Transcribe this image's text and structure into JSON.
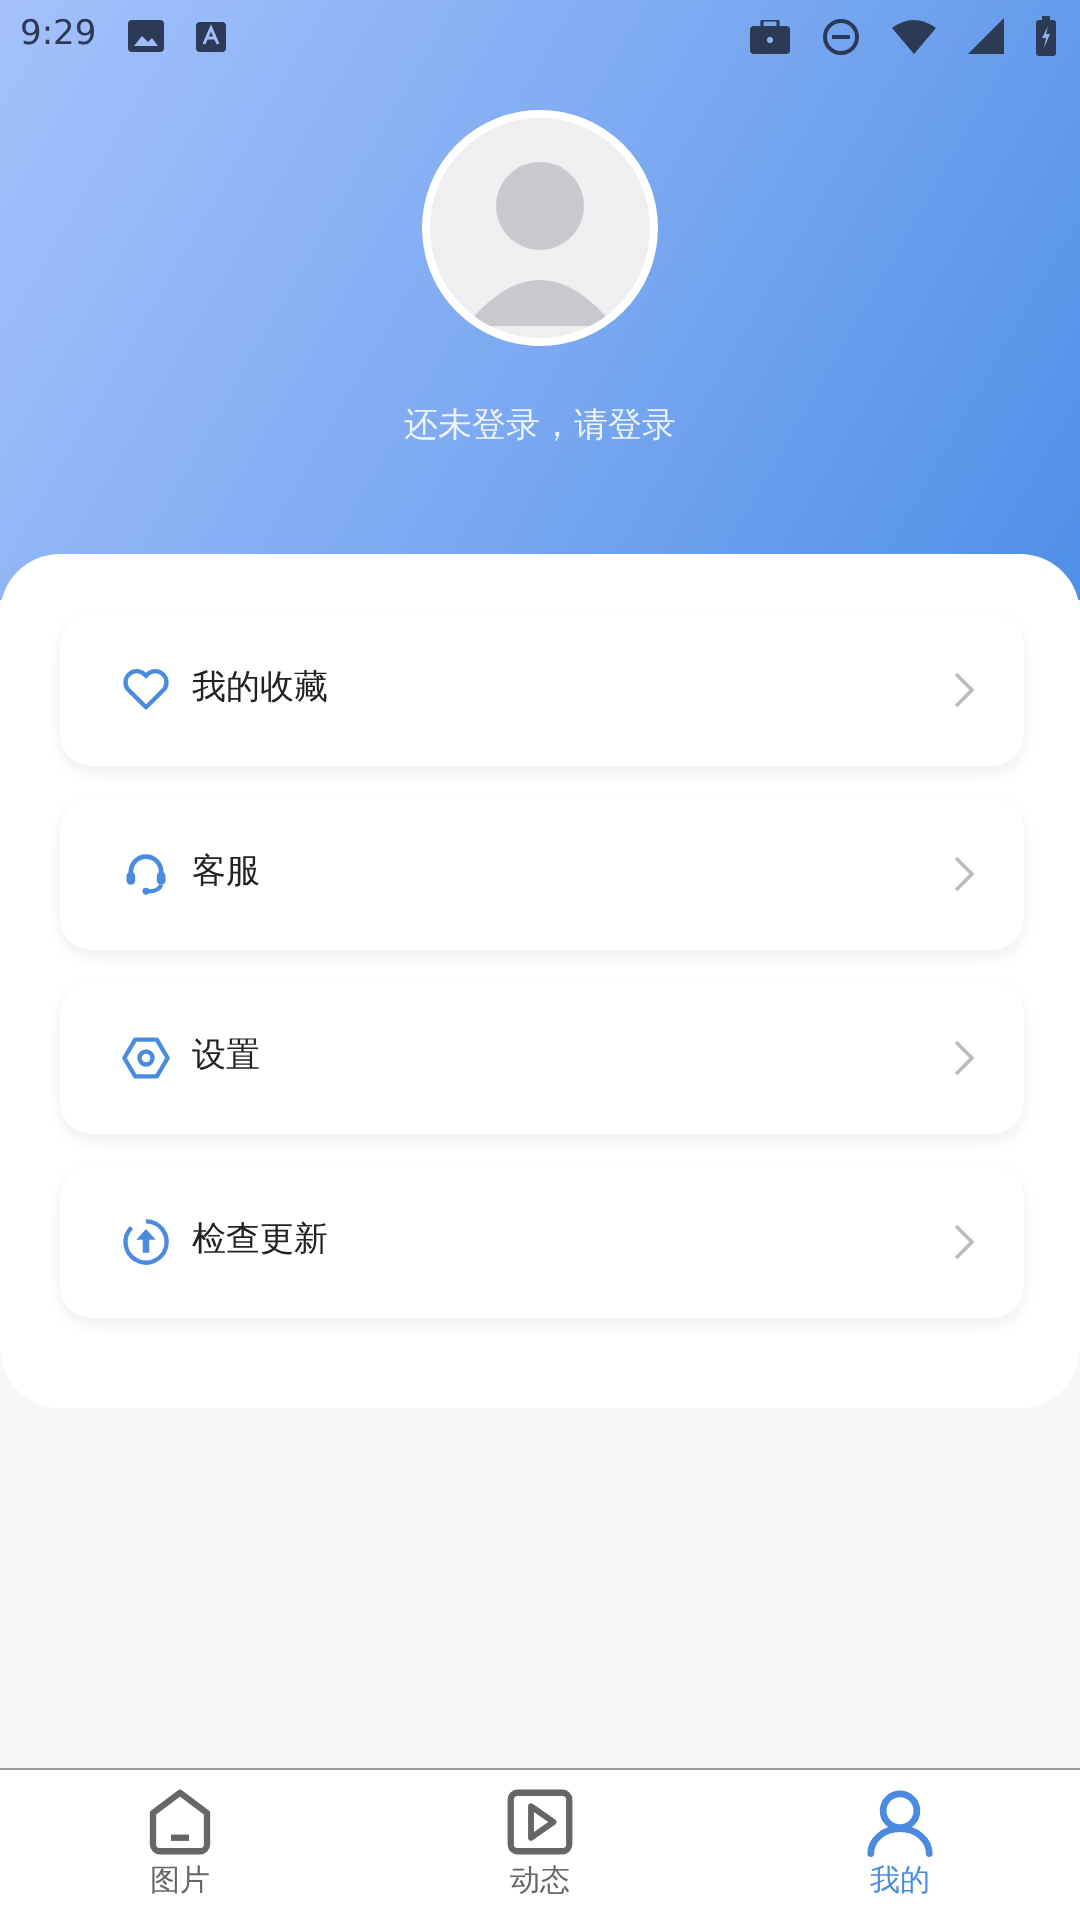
{
  "status_bar": {
    "time": "9:29"
  },
  "profile": {
    "login_prompt": "还未登录，请登录"
  },
  "menu": [
    {
      "label": "我的收藏"
    },
    {
      "label": "客服"
    },
    {
      "label": "设置"
    },
    {
      "label": "检查更新"
    }
  ],
  "bottom_nav": [
    {
      "label": "图片",
      "selected": false
    },
    {
      "label": "动态",
      "selected": false
    },
    {
      "label": "我的",
      "selected": true
    }
  ]
}
